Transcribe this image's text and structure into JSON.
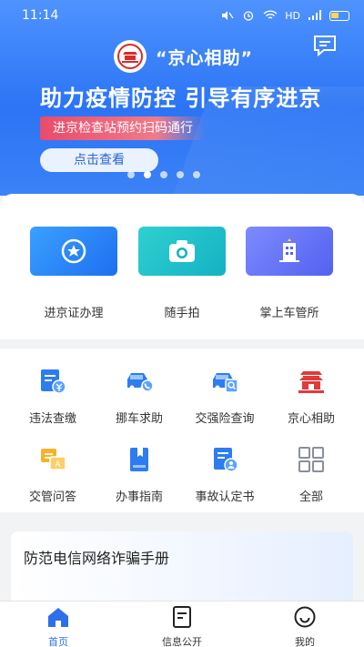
{
  "status_bar": {
    "time": "11:14",
    "network": "HD"
  },
  "header": {
    "title": "“京心相助”"
  },
  "banner": {
    "title": "助力疫情防控 引导有序进京",
    "subtitle": "进京检查站预约扫码通行",
    "button": "点击查看",
    "pages": 5,
    "active_page": 1
  },
  "features": [
    {
      "label": "进京证办理",
      "icon": "badge-star-icon"
    },
    {
      "label": "随手拍",
      "icon": "camera-icon"
    },
    {
      "label": "掌上车管所",
      "icon": "building-icon"
    }
  ],
  "services": [
    {
      "label": "违法查缴",
      "icon": "ticket-yen-icon"
    },
    {
      "label": "挪车求助",
      "icon": "car-phone-icon"
    },
    {
      "label": "交强险查询",
      "icon": "car-search-icon"
    },
    {
      "label": "京心相助",
      "icon": "beijing-gate-icon"
    },
    {
      "label": "交管问答",
      "icon": "qa-icon"
    },
    {
      "label": "办事指南",
      "icon": "book-icon"
    },
    {
      "label": "事故认定书",
      "icon": "document-user-icon"
    },
    {
      "label": "全部",
      "icon": "grid-icon"
    }
  ],
  "promo": {
    "title": "防范电信网络诈骗手册"
  },
  "tabs": [
    {
      "label": "首页",
      "icon": "home-icon",
      "active": true
    },
    {
      "label": "信息公开",
      "icon": "news-icon",
      "active": false
    },
    {
      "label": "我的",
      "icon": "smile-icon",
      "active": false
    }
  ],
  "colors": {
    "primary": "#2b74f5",
    "accent": "#e94b6b"
  }
}
